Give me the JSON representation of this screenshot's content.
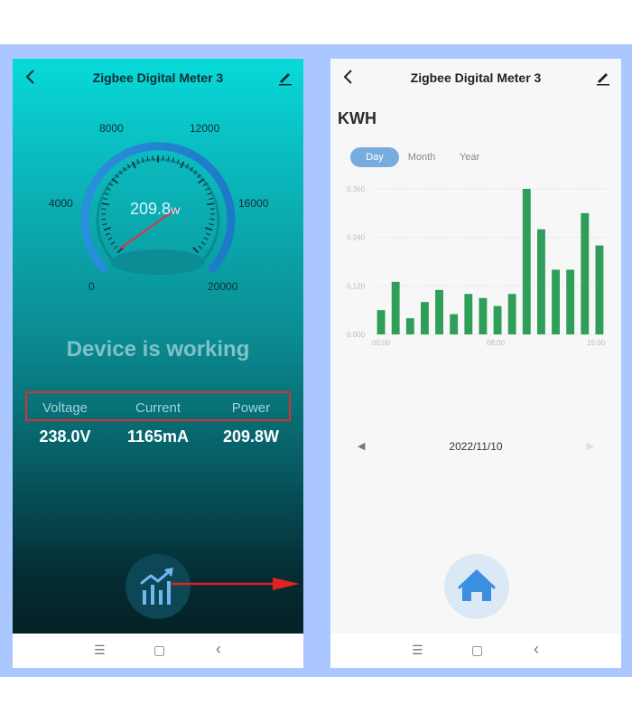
{
  "left_screen": {
    "title": "Zigbee Digital Meter 3",
    "gauge": {
      "ticks": [
        "0",
        "4000",
        "8000",
        "12000",
        "16000",
        "20000"
      ],
      "value": "209.8",
      "unit": "W",
      "max": 20000
    },
    "status": "Device is working",
    "metrics": [
      {
        "label": "Voltage",
        "value": "238.0V"
      },
      {
        "label": "Current",
        "value": "1165mA"
      },
      {
        "label": "Power",
        "value": "209.8W"
      }
    ]
  },
  "right_screen": {
    "title": "Zigbee Digital Meter 3",
    "heading": "KWH",
    "tabs": [
      {
        "label": "Day",
        "active": true
      },
      {
        "label": "Month",
        "active": false
      },
      {
        "label": "Year",
        "active": false
      }
    ],
    "date": "2022/11/10",
    "prev_symbol": "◀",
    "next_symbol": "▶"
  },
  "nav_symbols": {
    "menu": "☰",
    "home": "▢",
    "back": "‹"
  },
  "colors": {
    "bar": "#2e9e58",
    "accent": "#78ace0",
    "gauge_arc": "#2a8fdc",
    "needle": "#e0304a"
  },
  "chart_data": {
    "type": "bar",
    "y_ticks": [
      "0.000",
      "0.120",
      "0.240",
      "0.360"
    ],
    "x_ticks": [
      "00:00",
      "08:00",
      "15:00"
    ],
    "ylim": [
      0,
      0.36
    ],
    "values": [
      0.06,
      0.13,
      0.04,
      0.08,
      0.11,
      0.05,
      0.1,
      0.09,
      0.07,
      0.1,
      0.36,
      0.26,
      0.16,
      0.16,
      0.3,
      0.22
    ],
    "xlabel": "",
    "ylabel": ""
  }
}
